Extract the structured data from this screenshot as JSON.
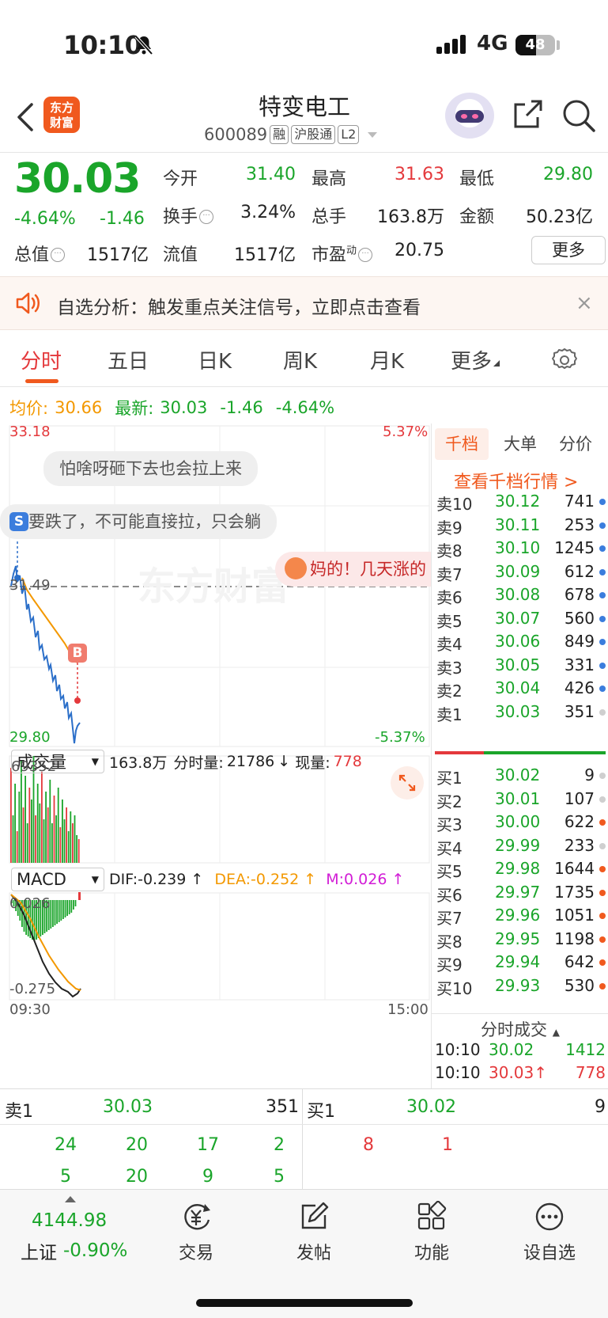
{
  "status_bar": {
    "time": "10:10",
    "network": "4G",
    "battery": "48"
  },
  "header": {
    "logo_line1": "东方",
    "logo_line2": "财富",
    "stock_name": "特变电工",
    "stock_code": "600089",
    "tags": [
      "融",
      "沪股通",
      "L2"
    ]
  },
  "quote": {
    "price": "30.03",
    "change_pct": "-4.64%",
    "change": "-1.46",
    "fields": [
      {
        "label": "今开",
        "value": "31.40",
        "color": "green"
      },
      {
        "label": "最高",
        "value": "31.63",
        "color": "red"
      },
      {
        "label": "最低",
        "value": "29.80",
        "color": "green"
      },
      {
        "label": "换手",
        "value": "3.24%",
        "color": "plain"
      },
      {
        "label": "总手",
        "value": "163.8万",
        "color": "plain"
      },
      {
        "label": "金额",
        "value": "50.23亿",
        "color": "plain"
      },
      {
        "label": "总值",
        "value": "1517亿",
        "color": "plain"
      },
      {
        "label": "流值",
        "value": "1517亿",
        "color": "plain"
      },
      {
        "label": "市盈",
        "sup": "动",
        "value": "20.75",
        "color": "plain"
      }
    ],
    "more_label": "更多"
  },
  "alert": {
    "text": "自选分析：触发重点关注信号，立即点击查看",
    "close": "×"
  },
  "tabs": [
    "分时",
    "五日",
    "日K",
    "周K",
    "月K",
    "更多"
  ],
  "avg_line": {
    "avg_label": "均价:",
    "avg_value": "30.66",
    "latest_label": "最新:",
    "latest_value": "30.03",
    "change": "-1.46",
    "change_pct": "-4.64%"
  },
  "chart": {
    "price_high": "33.18",
    "price_low": "29.80",
    "pct_high": "5.37%",
    "pct_low": "-5.37%",
    "prev_close": "31.49",
    "watermark": "东方财富",
    "time_start": "09:30",
    "time_end": "15:00",
    "danmu": [
      "怕啥呀砸下去也会拉上来",
      "要跌了，不可能直接拉，只会躺",
      "妈的！几天涨的"
    ],
    "markers": {
      "sell": "S",
      "buy": "B"
    },
    "volume_selector": "成交量",
    "volume_total": "163.8万",
    "volume_fenshi_label": "分时量:",
    "volume_fenshi": "21786",
    "volume_now_label": "现量:",
    "volume_now": "778",
    "volume_max": "69352",
    "macd_selector": "MACD",
    "dif": "DIF:-0.239 ↑",
    "dea": "DEA:-0.252 ↑",
    "m": "M:0.026 ↑",
    "macd_top": "0.026",
    "macd_bottom": "-0.275"
  },
  "order_book": {
    "tabs": [
      "千档",
      "大单",
      "分价"
    ],
    "link": "查看千档行情 >",
    "asks": [
      {
        "label": "卖10",
        "price": "30.12",
        "vol": "741"
      },
      {
        "label": "卖9",
        "price": "30.11",
        "vol": "253"
      },
      {
        "label": "卖8",
        "price": "30.10",
        "vol": "1245"
      },
      {
        "label": "卖7",
        "price": "30.09",
        "vol": "612"
      },
      {
        "label": "卖6",
        "price": "30.08",
        "vol": "678"
      },
      {
        "label": "卖5",
        "price": "30.07",
        "vol": "560"
      },
      {
        "label": "卖4",
        "price": "30.06",
        "vol": "849"
      },
      {
        "label": "卖3",
        "price": "30.05",
        "vol": "331"
      },
      {
        "label": "卖2",
        "price": "30.04",
        "vol": "426"
      },
      {
        "label": "卖1",
        "price": "30.03",
        "vol": "351"
      }
    ],
    "bids": [
      {
        "label": "买1",
        "price": "30.02",
        "vol": "9"
      },
      {
        "label": "买2",
        "price": "30.01",
        "vol": "107"
      },
      {
        "label": "买3",
        "price": "30.00",
        "vol": "622"
      },
      {
        "label": "买4",
        "price": "29.99",
        "vol": "233"
      },
      {
        "label": "买5",
        "price": "29.98",
        "vol": "1644"
      },
      {
        "label": "买6",
        "price": "29.97",
        "vol": "1735"
      },
      {
        "label": "买7",
        "price": "29.96",
        "vol": "1051"
      },
      {
        "label": "买8",
        "price": "29.95",
        "vol": "1198"
      },
      {
        "label": "买9",
        "price": "29.94",
        "vol": "642"
      },
      {
        "label": "买10",
        "price": "29.93",
        "vol": "530"
      }
    ],
    "ticks_title": "分时成交",
    "ticks": [
      {
        "time": "10:10",
        "price": "30.02",
        "vol": "1412",
        "dir": ""
      },
      {
        "time": "10:10",
        "price": "30.03",
        "vol": "778",
        "dir": "↑"
      }
    ]
  },
  "strip": {
    "ask1_label": "卖1",
    "ask1_price": "30.03",
    "ask1_vol": "351",
    "bid1_label": "买1",
    "bid1_price": "30.02",
    "bid1_vol": "9",
    "ask_queue": [
      "24",
      "20",
      "17",
      "2",
      "5",
      "20",
      "9",
      "5"
    ],
    "bid_queue": [
      "8",
      "1"
    ]
  },
  "bottom_nav": {
    "index_value": "4144.98",
    "index_name": "上证",
    "index_change": "-0.90%",
    "items": [
      "交易",
      "发帖",
      "功能",
      "设自选"
    ]
  },
  "colors": {
    "up": "#e4393c",
    "down": "#1aa52a",
    "avg": "#f39800",
    "price_line": "#2b6fc9",
    "accent": "#f0591e"
  }
}
